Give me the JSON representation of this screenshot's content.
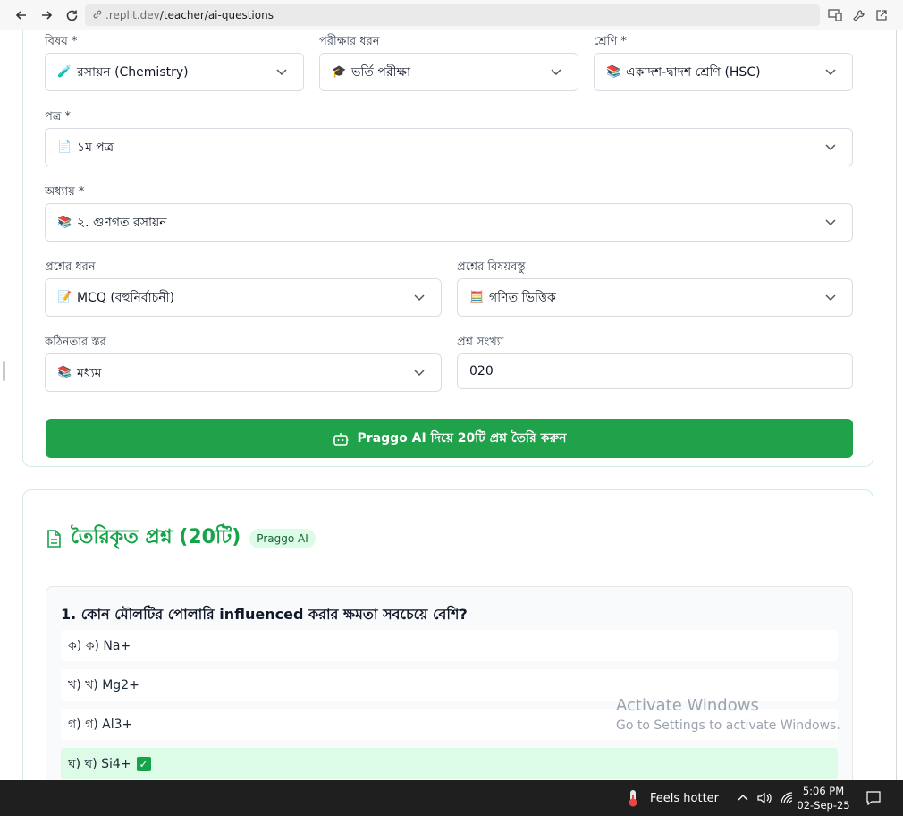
{
  "browser": {
    "url_prefix": ".replit.dev",
    "url_path": "/teacher/ai-questions"
  },
  "form": {
    "subject": {
      "label": "বিষয় *",
      "value": "রসায়ন (Chemistry)",
      "icon": "🧪"
    },
    "exam_type": {
      "label": "পরীক্ষার ধরন",
      "value": "ভর্তি পরীক্ষা",
      "icon": "🎓"
    },
    "class": {
      "label": "শ্রেণি *",
      "value": "একাদশ-দ্বাদশ শ্রেণি (HSC)",
      "icon": "📚"
    },
    "paper": {
      "label": "পত্র *",
      "value": "১ম পত্র",
      "icon": "📄"
    },
    "chapter": {
      "label": "অধ্যায় *",
      "value": "২. গুণগত রসায়ন",
      "icon": "📚"
    },
    "question_type": {
      "label": "প্রশ্নের ধরন",
      "value": "MCQ (বহুনির্বাচনী)",
      "icon": "📝"
    },
    "question_content": {
      "label": "প্রশ্নের বিষয়বস্তু",
      "value": "গণিত ভিত্তিক",
      "icon": "🧮"
    },
    "difficulty": {
      "label": "কঠিনতার স্তর",
      "value": "মধ্যম",
      "icon": "📚"
    },
    "count": {
      "label": "প্রশ্ন সংখ্যা",
      "value": "020"
    },
    "generate_button": "Praggo AI দিয়ে 20টি প্রশ্ন তৈরি করুন"
  },
  "results": {
    "title": "তৈরিকৃত প্রশ্ন (20টি)",
    "badge": "Praggo AI",
    "question": {
      "text": "1. কোন মৌলটির পোলারি influenced করার ক্ষমতা সবচেয়ে বেশি?",
      "options": [
        {
          "text": "ক) ক) Na+",
          "correct": false
        },
        {
          "text": "খ) খ) Mg2+",
          "correct": false
        },
        {
          "text": "গ) গ) Al3+",
          "correct": false
        },
        {
          "text": "ঘ) ঘ) Si4+",
          "correct": true
        }
      ]
    }
  },
  "watermark": {
    "line1": "Activate Windows",
    "line2": "Go to Settings to activate Windows."
  },
  "taskbar": {
    "weather": "Feels hotter",
    "time": "5:06 PM",
    "date": "02-Sep-25"
  },
  "colors": {
    "accent": "#20a24a",
    "title_green": "#16a34a",
    "card_border": "#cfeedd",
    "correct_bg": "#dcfce7"
  }
}
